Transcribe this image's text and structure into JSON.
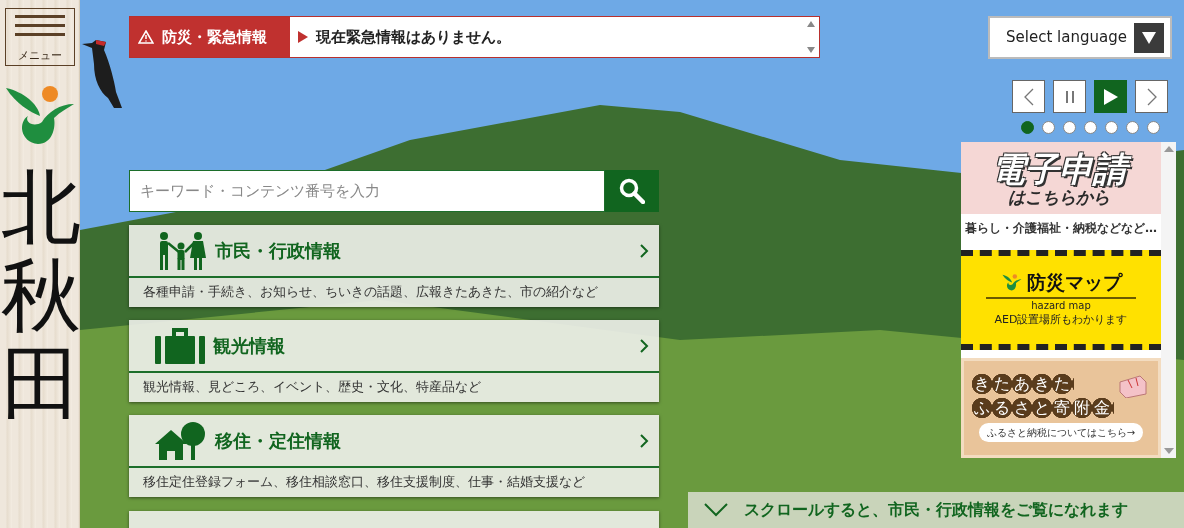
{
  "menu": {
    "label": "メニュー"
  },
  "city_name": "北秋田",
  "emergency": {
    "label": "防災・緊急情報",
    "message": "現在緊急情報はありません。"
  },
  "language": {
    "label": "Select language"
  },
  "slideshow": {
    "playing": true,
    "slides": [
      {
        "selected": true
      },
      {
        "selected": false
      },
      {
        "selected": false
      },
      {
        "selected": false
      },
      {
        "selected": false
      },
      {
        "selected": false
      },
      {
        "selected": false
      }
    ]
  },
  "search": {
    "placeholder": "キーワード・コンテンツ番号を入力"
  },
  "categories": [
    {
      "kind": "family",
      "title": "市民・行政情報",
      "description": "各種申請・手続き、お知らせ、ちいきの話題、広報きたあきた、市の紹介など"
    },
    {
      "kind": "suitcase",
      "title": "観光情報",
      "description": "観光情報、見どころ、イベント、歴史・文化、特産品など"
    },
    {
      "kind": "house",
      "title": "移住・定住情報",
      "description": "移住定住登録フォーム、移住相談窓口、移住支援制度、仕事・結婚支援など"
    }
  ],
  "banners": [
    {
      "kind": "e-application",
      "title": "電子申請",
      "subtitle": "はこちらから",
      "caption": "暮らし・介護福祉・納税などなど…"
    },
    {
      "kind": "hazard-map",
      "title": "防災マップ",
      "subtitle": "hazard map",
      "caption": "AED設置場所もわかります"
    },
    {
      "kind": "furusato",
      "title_lines": [
        "きたあきた",
        "ふるさと寄附金"
      ],
      "caption": "ふるさと納税についてはこちら→"
    }
  ],
  "scroll_hint": "スクロールすると、市民・行政情報をご覧になれます"
}
